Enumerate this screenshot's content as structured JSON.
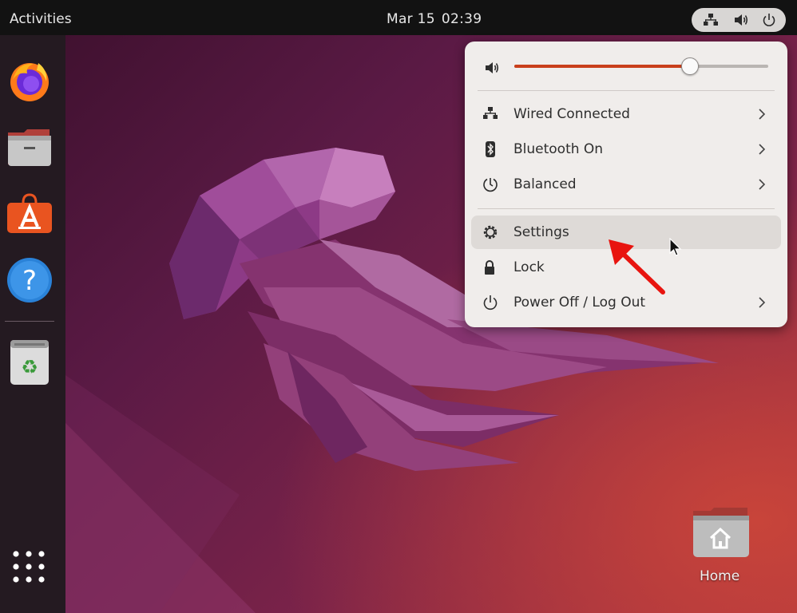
{
  "topbar": {
    "activities": "Activities",
    "date": "Mar 15",
    "time": "02:39",
    "status_icons": [
      "network-wired-icon",
      "speaker-icon",
      "power-icon"
    ]
  },
  "dock": {
    "apps": [
      "firefox-icon",
      "files-icon",
      "software-store-icon",
      "help-icon",
      "trash-icon"
    ],
    "show_apps_icon": "app-grid-icon"
  },
  "quick_settings": {
    "volume": {
      "icon": "speaker-icon",
      "level": 0.69
    },
    "items": [
      {
        "icon": "network-wired-icon",
        "label": "Wired Connected",
        "has_submenu": true
      },
      {
        "icon": "bluetooth-icon",
        "label": "Bluetooth On",
        "has_submenu": true
      },
      {
        "icon": "power-profile-icon",
        "label": "Balanced",
        "has_submenu": true
      },
      {
        "icon": "gear-icon",
        "label": "Settings",
        "has_submenu": false,
        "hovered": true
      },
      {
        "icon": "lock-icon",
        "label": "Lock",
        "has_submenu": false
      },
      {
        "icon": "power-icon",
        "label": "Power Off / Log Out",
        "has_submenu": true
      }
    ]
  },
  "desktop": {
    "home_label": "Home"
  },
  "colors": {
    "accent": "#c93f1b",
    "annotation_arrow": "#e8140f",
    "menu_bg": "#f0edeb"
  }
}
